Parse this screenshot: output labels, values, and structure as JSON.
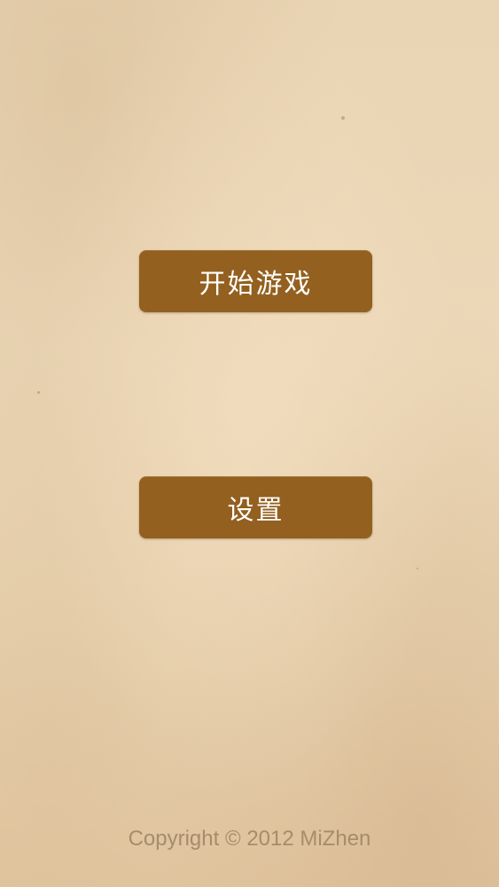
{
  "menu": {
    "start_label": "开始游戏",
    "settings_label": "设置"
  },
  "footer": {
    "copyright": "Copyright © 2012 MiZhen"
  },
  "colors": {
    "background": "#e9d4b3",
    "button": "#93601f",
    "button_text": "#ffffff",
    "footer_text": "#a58c6c"
  }
}
